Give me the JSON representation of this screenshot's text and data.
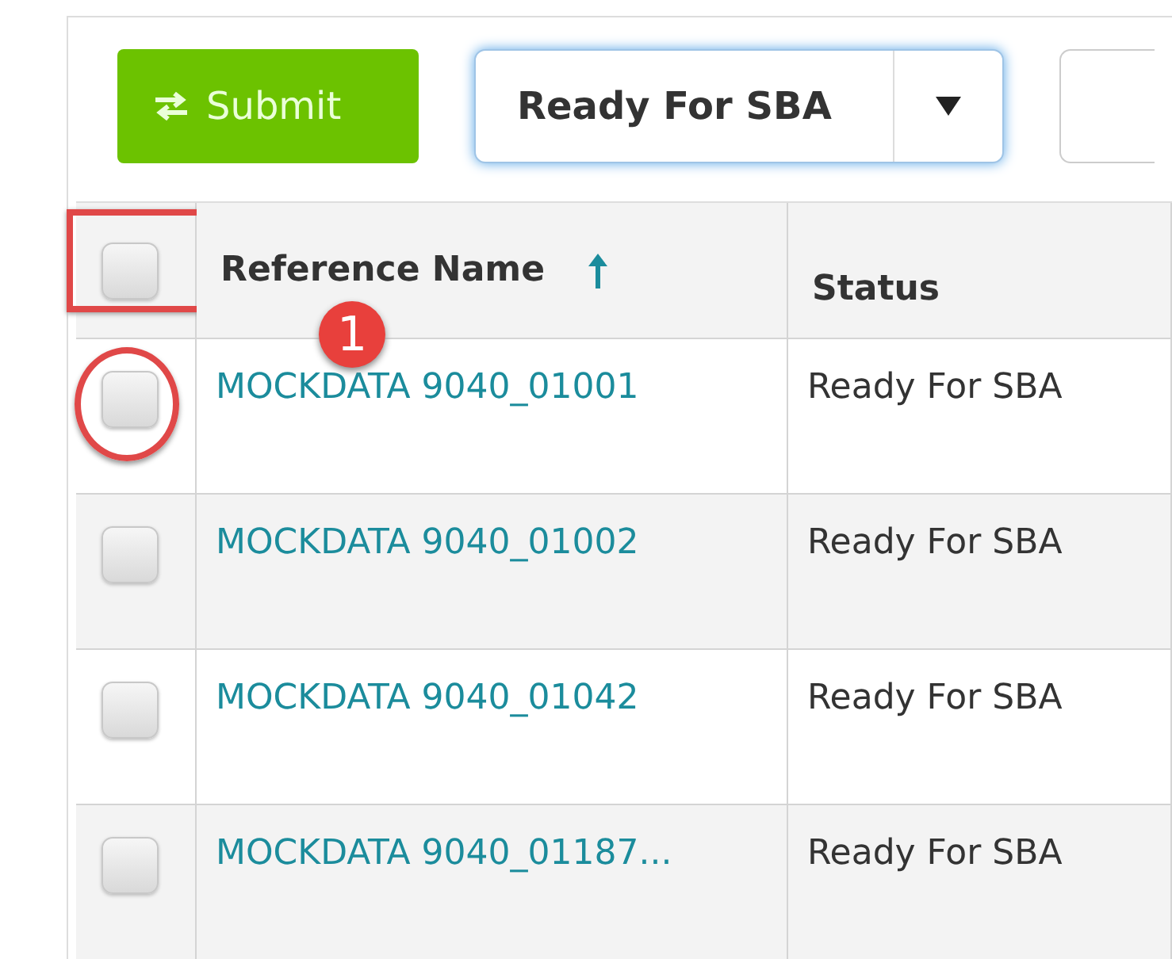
{
  "toolbar": {
    "submit_button": "Submit",
    "status_dropdown": {
      "value": "Ready For SBA"
    }
  },
  "table": {
    "select_all": {
      "checked": false,
      "highlighted": true
    },
    "columns": [
      {
        "label": "Reference Name",
        "sorted": true
      },
      {
        "label": "Status",
        "sorted": false
      }
    ],
    "rows": [
      {
        "reference": "MOCKDATA 9040_01001",
        "status": "Ready For SBA",
        "checked": false,
        "circled": true
      },
      {
        "reference": "MOCKDATA 9040_01002",
        "status": "Ready For SBA",
        "checked": false,
        "circled": false
      },
      {
        "reference": "MOCKDATA 9040_01042",
        "status": "Ready For SBA",
        "checked": false,
        "circled": false
      },
      {
        "reference": "MOCKDATA 9040_01187...",
        "status": "Ready For SBA",
        "checked": false,
        "circled": false
      }
    ]
  },
  "annotation": {
    "badge": "1"
  }
}
